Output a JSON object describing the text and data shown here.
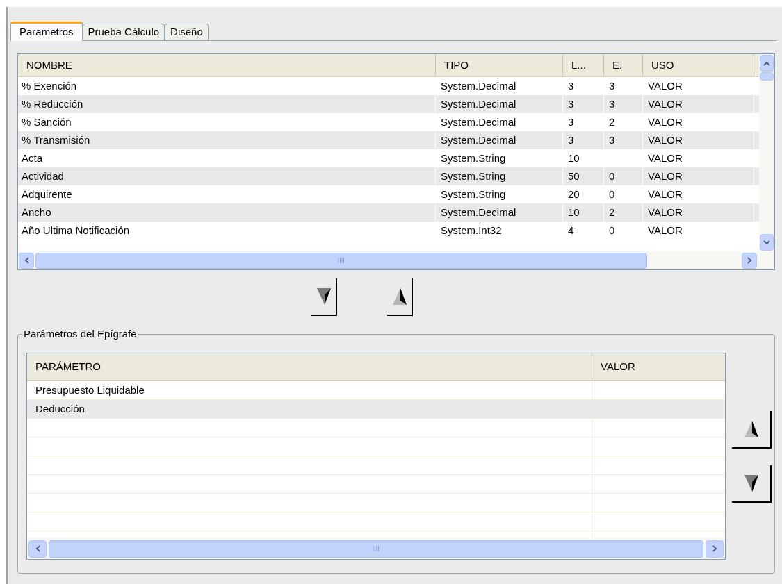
{
  "tabs": [
    {
      "label": "Parametros",
      "selected": true
    },
    {
      "label": "Prueba Cálculo",
      "selected": false
    },
    {
      "label": "Diseño",
      "selected": false
    }
  ],
  "variables_table": {
    "columns": [
      "NOMBRE",
      "TIPO",
      "L...",
      "E.",
      "USO"
    ],
    "rows": [
      [
        "% Exención",
        "System.Decimal",
        "3",
        "3",
        "VALOR"
      ],
      [
        "% Reducción",
        "System.Decimal",
        "3",
        "3",
        "VALOR"
      ],
      [
        "% Sanción",
        "System.Decimal",
        "3",
        "2",
        "VALOR"
      ],
      [
        "% Transmisión",
        "System.Decimal",
        "3",
        "3",
        "VALOR"
      ],
      [
        "Acta",
        "System.String",
        "10",
        "",
        "VALOR"
      ],
      [
        "Actividad",
        "System.String",
        "50",
        "0",
        "VALOR"
      ],
      [
        "Adquirente",
        "System.String",
        "20",
        "0",
        "VALOR"
      ],
      [
        "Ancho",
        "System.Decimal",
        "10",
        "2",
        "VALOR"
      ],
      [
        "Año Ultima Notificación",
        "System.Int32",
        "4",
        "0",
        "VALOR"
      ]
    ]
  },
  "group": {
    "title": "Parámetros del Epígrafe",
    "table": {
      "columns": [
        "PARÁMETRO",
        "VALOR"
      ],
      "rows": [
        [
          "Presupuesto Liquidable",
          ""
        ],
        [
          "Deducción",
          ""
        ]
      ]
    }
  }
}
